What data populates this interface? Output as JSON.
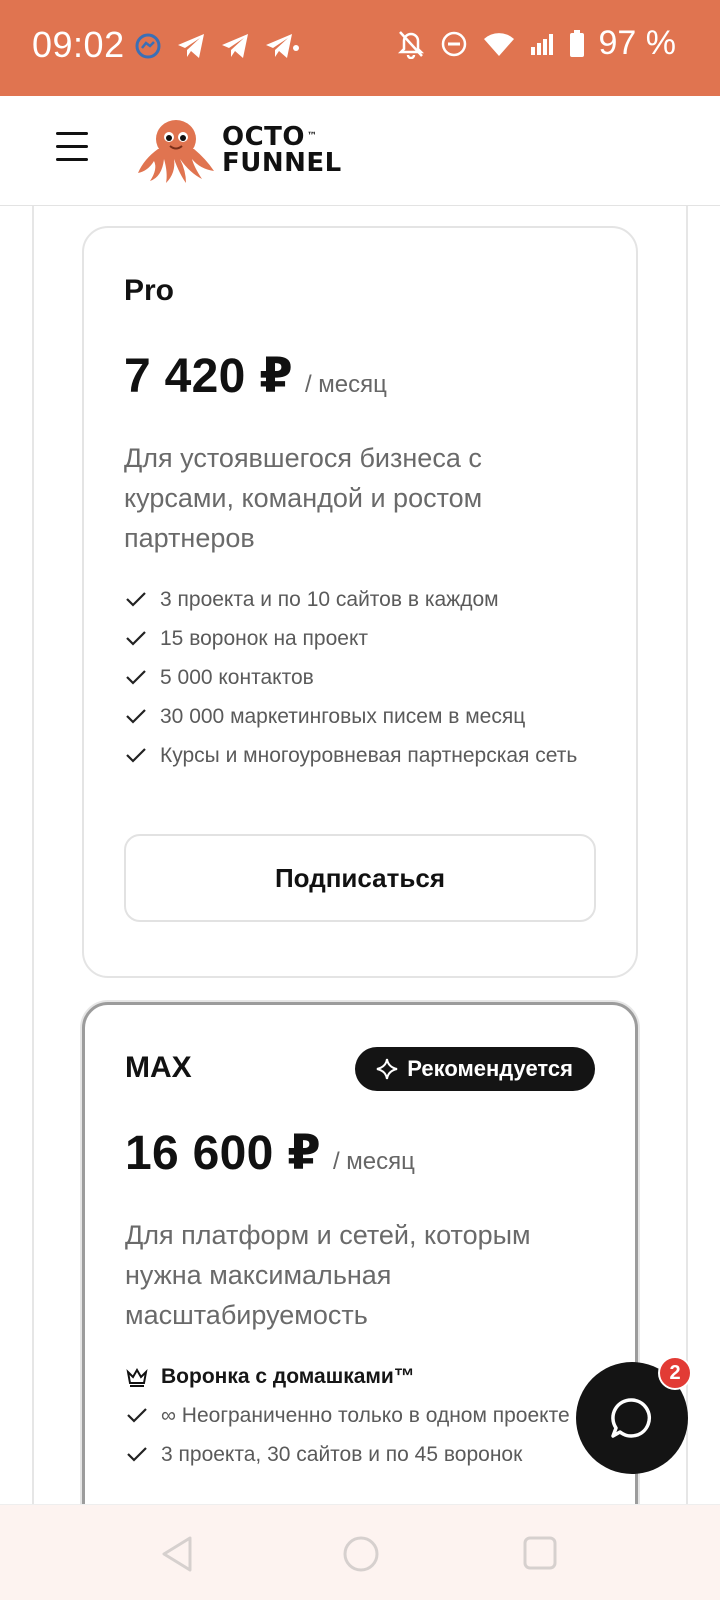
{
  "status_bar": {
    "time": "09:02",
    "battery": "97 %",
    "icons_left": [
      "messenger-icon",
      "telegram-icon",
      "telegram-icon",
      "telegram-icon"
    ],
    "icons_right": [
      "bell-off-icon",
      "do-not-disturb-icon",
      "wifi-icon",
      "signal-icon",
      "battery-icon"
    ],
    "bg_color": "#e07450"
  },
  "header": {
    "logo_line1": "OCTO",
    "logo_line2": "FUNNEL",
    "logo_tm": "™"
  },
  "plans": [
    {
      "name": "Pro",
      "price": "7 420 ₽",
      "period": "/ месяц",
      "description": "Для устоявшегося бизнеса с курсами, командой и ростом партнеров",
      "features": [
        "3 проекта и по 10 сайтов в каждом",
        "15 воронок на проект",
        "5 000 контактов",
        "30 000 маркетинговых писем в месяц",
        "Курсы и многоуровневая партнерская сеть"
      ],
      "button": "Подписаться"
    },
    {
      "name": "MAX",
      "badge": "Рекомендуется",
      "price": "16 600 ₽",
      "period": "/ месяц",
      "description": "Для платформ и сетей, которым нужна максимальная масштабируемость",
      "feature_highlight": "Воронка с домашками™",
      "features": [
        "∞ Неограниченно только в одном проекте",
        "3 проекта, 30 сайтов и по 45 воронок"
      ]
    }
  ],
  "chat": {
    "unread": "2"
  },
  "colors": {
    "accent": "#e07450",
    "dark": "#141414",
    "badge_red": "#e23b35"
  }
}
